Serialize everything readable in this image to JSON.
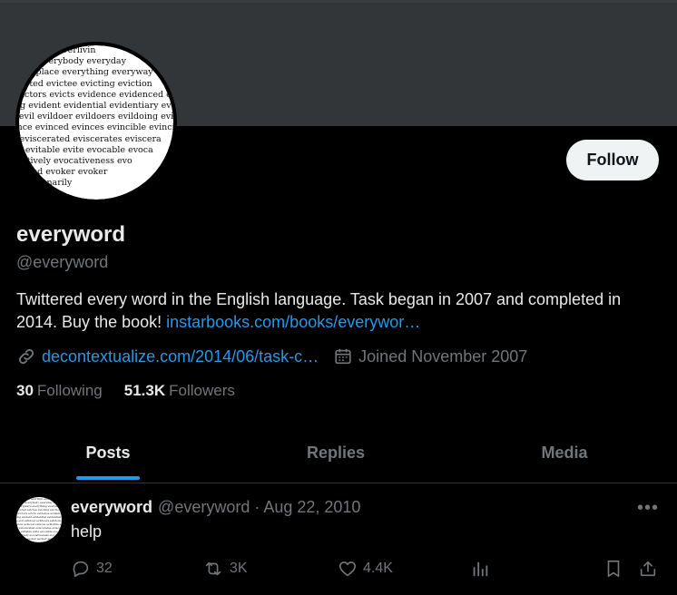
{
  "profile": {
    "name": "everyword",
    "handle": "@everyword",
    "follow_label": "Follow",
    "bio_text": "Twittered every word in the English language. Task began in 2007 and completed in 2014. Buy the book! ",
    "bio_link": "instarbooks.com/books/everywor…",
    "website": "decontextualize.com/2014/06/task-c…",
    "joined": "Joined November 2007",
    "following_count": "30",
    "following_label": "Following",
    "followers_count": "51.3K",
    "followers_label": "Followers",
    "avatar_words": [
      "erlastings everlivin",
      "every everybody everyday",
      "everyplace everything everyway",
      "evicted evictee evicting eviction",
      "evictors evicts evidence evidenced ev",
      "ing evident evidential evidentiary ev",
      "s evil evildoer evildoers evildoing evil",
      "ence evinced evinces evincible evincin",
      "e eviscerated eviscerates eviscera",
      "on evitable evite evocable evoca",
      "ocatively evocativeness evo",
      "evoked evoker evoker",
      "evolutionarily"
    ]
  },
  "tabs": [
    {
      "label": "Posts",
      "active": true
    },
    {
      "label": "Replies",
      "active": false
    },
    {
      "label": "Media",
      "active": false
    }
  ],
  "post": {
    "name": "everyword",
    "handle_date": "@everyword · Aug 22, 2010",
    "text": "help",
    "replies": "32",
    "reposts": "3K",
    "likes": "4.4K",
    "icons": [
      "reply-icon",
      "repost-icon",
      "like-icon",
      "views-icon",
      "bookmark-icon",
      "share-icon"
    ]
  },
  "colors": {
    "accent": "#1d9bf0",
    "background": "#000000",
    "banner": "#333639",
    "muted": "#71767b"
  }
}
